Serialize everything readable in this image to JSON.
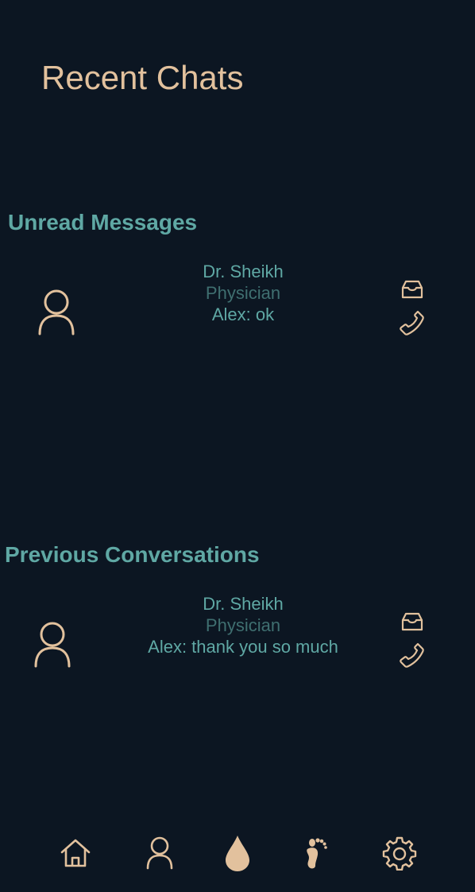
{
  "header": {
    "title": "Recent Chats"
  },
  "sections": {
    "unread": {
      "title": "Unread Messages",
      "chat": {
        "name": "Dr. Sheikh",
        "role": "Physician",
        "last_message": "Alex: ok"
      }
    },
    "previous": {
      "title": "Previous Conversations",
      "chat": {
        "name": "Dr. Sheikh",
        "role": "Physician",
        "last_message": "Alex: thank you so much"
      }
    }
  },
  "icons": {
    "avatar": "user-icon",
    "message": "inbox-icon",
    "call": "phone-icon"
  },
  "bottom_nav": {
    "items": [
      {
        "icon": "home-icon"
      },
      {
        "icon": "user-icon"
      },
      {
        "icon": "drop-icon",
        "active": true
      },
      {
        "icon": "footprint-icon"
      },
      {
        "icon": "gear-icon"
      }
    ]
  },
  "colors": {
    "background": "#0c1622",
    "accent": "#e2c19d",
    "teal": "#5fa8a4",
    "teal_muted": "#3f6f70"
  }
}
